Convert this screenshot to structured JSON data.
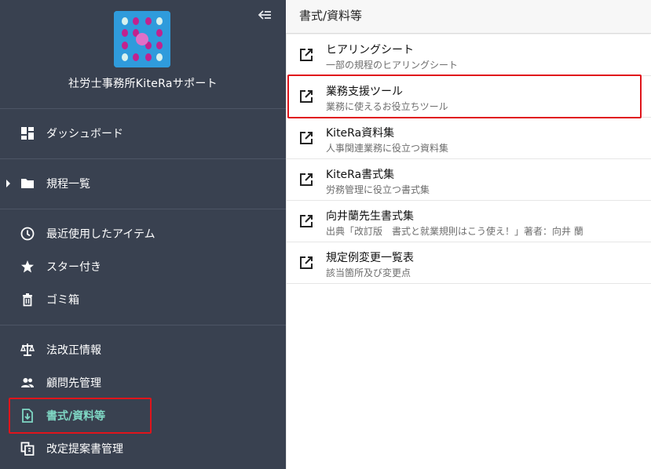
{
  "sidebar": {
    "brand": "社労士事務所KiteRaサポート",
    "collapse_icon": "collapse-left-icon",
    "groups": [
      [
        {
          "label": "ダッシュボード",
          "icon": "dashboard-icon"
        }
      ],
      [
        {
          "label": "規程一覧",
          "icon": "folder-icon",
          "expandable": true
        }
      ],
      [
        {
          "label": "最近使用したアイテム",
          "icon": "clock-icon"
        },
        {
          "label": "スター付き",
          "icon": "star-icon"
        },
        {
          "label": "ゴミ箱",
          "icon": "trash-icon"
        }
      ],
      [
        {
          "label": "法改正情報",
          "icon": "scale-icon"
        },
        {
          "label": "顧問先管理",
          "icon": "people-icon"
        },
        {
          "label": "書式/資料等",
          "icon": "document-download-icon",
          "active": true
        },
        {
          "label": "改定提案書管理",
          "icon": "copy-document-icon"
        }
      ]
    ],
    "active_color": "#7fd7c4",
    "background": "#394150"
  },
  "main": {
    "title": "書式/資料等",
    "items": [
      {
        "title": "ヒアリングシート",
        "subtitle": "一部の規程のヒアリングシート",
        "icon": "open-in-new-icon"
      },
      {
        "title": "業務支援ツール",
        "subtitle": "業務に使えるお役立ちツール",
        "icon": "open-in-new-icon",
        "highlighted": true
      },
      {
        "title": "KiteRa資料集",
        "subtitle": "人事関連業務に役立つ資料集",
        "icon": "open-in-new-icon"
      },
      {
        "title": "KiteRa書式集",
        "subtitle": "労務管理に役立つ書式集",
        "icon": "open-in-new-icon"
      },
      {
        "title": "向井蘭先生書式集",
        "subtitle": "出典「改訂版　書式と就業規則はこう使え！」著者：向井 蘭",
        "icon": "open-in-new-icon"
      },
      {
        "title": "規定例変更一覧表",
        "subtitle": "該当箇所及び変更点",
        "icon": "open-in-new-icon"
      }
    ]
  },
  "highlight_color": "#e0141b"
}
